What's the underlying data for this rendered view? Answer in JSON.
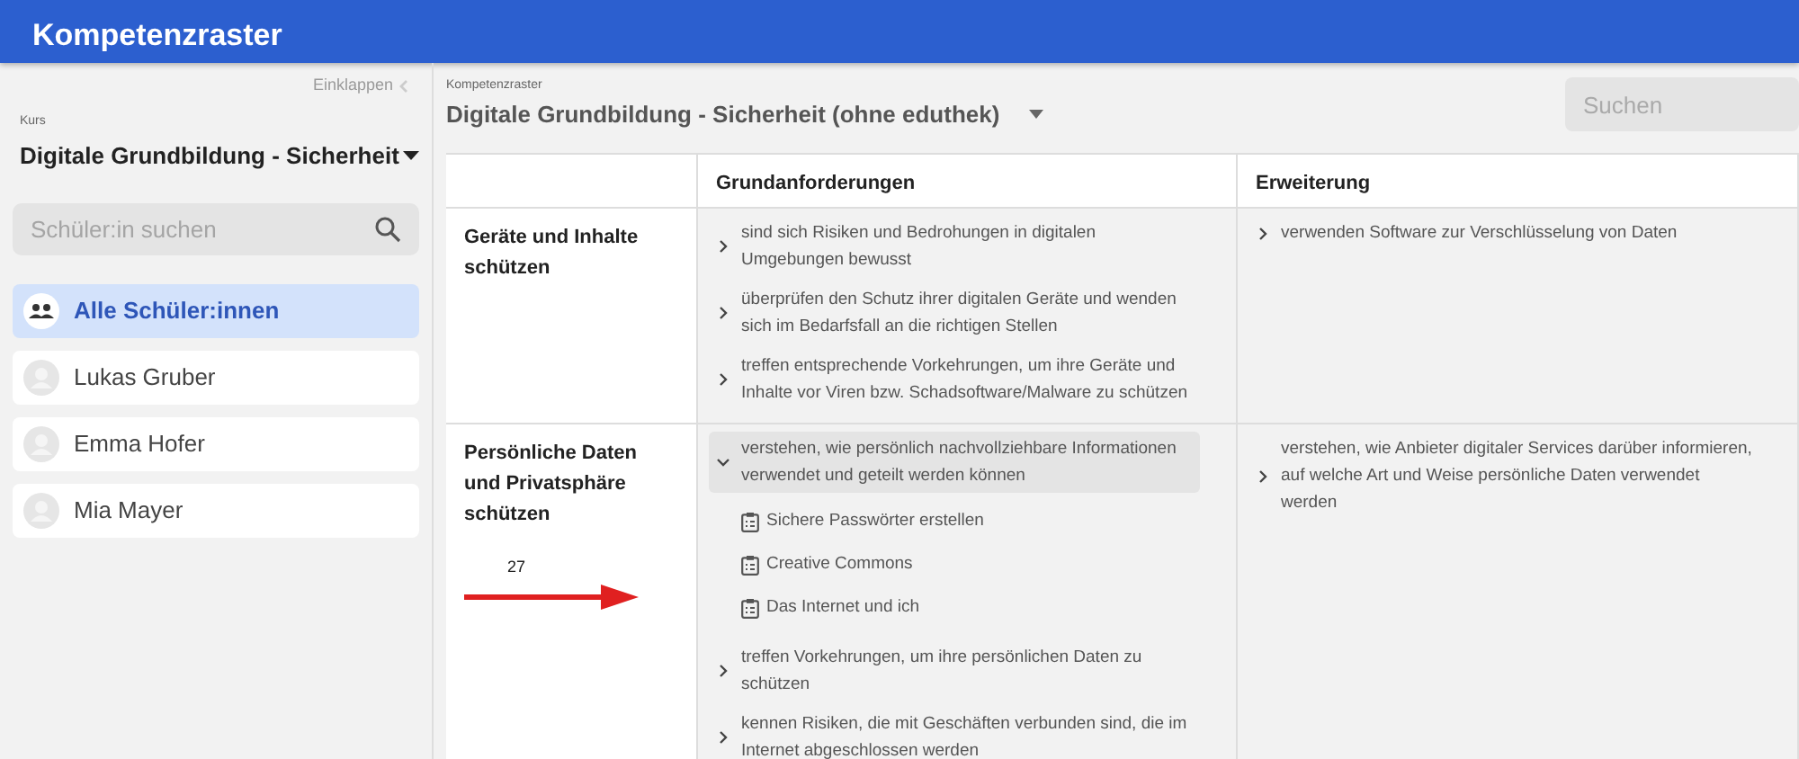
{
  "app_bar": {
    "title": "Kompetenzraster"
  },
  "sidebar": {
    "collapse_label": "Einklappen",
    "course_label": "Kurs",
    "course": "Digitale Grundbildung - Sicherheit",
    "search_placeholder": "Schüler:in suchen",
    "students": [
      {
        "name": "Alle Schüler:innen",
        "kind": "group",
        "selected": true
      },
      {
        "name": "Lukas Gruber",
        "kind": "person",
        "selected": false
      },
      {
        "name": "Emma Hofer",
        "kind": "person",
        "selected": false
      },
      {
        "name": "Mia Mayer",
        "kind": "person",
        "selected": false
      }
    ]
  },
  "grid": {
    "label": "Kompetenzraster",
    "title": "Digitale Grundbildung - Sicherheit (ohne eduthek)",
    "search_placeholder": "Suchen",
    "columns": [
      "Grundanforderungen",
      "Erweiterung"
    ],
    "rows": [
      {
        "heading": "Geräte und Inhalte schützen",
        "annotation": null,
        "basic": [
          {
            "text": "sind sich Risiken und Bedrohungen in digitalen Umgebungen bewusst",
            "expanded": false
          },
          {
            "text": "überprüfen den Schutz ihrer digitalen Geräte und wenden sich im Bedarfsfall an die richtigen Stellen",
            "expanded": false
          },
          {
            "text": "treffen entsprechende Vorkehrungen, um ihre Geräte und Inhalte vor Viren bzw. Schadsoftware/Malware zu schützen",
            "expanded": false
          }
        ],
        "extended": [
          {
            "text": "verwenden Software zur Verschlüsselung von Daten",
            "expanded": false
          }
        ]
      },
      {
        "heading": "Persönliche Daten und Privatsphäre schützen",
        "annotation": "27",
        "basic": [
          {
            "text": "verstehen, wie persönlich nachvollziehbare Informationen verwendet und geteilt werden können",
            "expanded": true,
            "children": [
              {
                "title": "Sichere Passwörter erstellen"
              },
              {
                "title": "Creative Commons"
              },
              {
                "title": "Das Internet und ich"
              }
            ]
          },
          {
            "text": "treffen Vorkehrungen, um ihre persönlichen Daten zu schützen",
            "expanded": false
          },
          {
            "text": "kennen Risiken, die mit Geschäften verbunden sind, die im Internet abgeschlossen werden",
            "expanded": false
          }
        ],
        "extended": [
          {
            "text": "verstehen, wie Anbieter digitaler Services darüber informieren, auf welche Art und Weise persönliche Daten verwendet werden",
            "expanded": false
          }
        ]
      }
    ]
  }
}
